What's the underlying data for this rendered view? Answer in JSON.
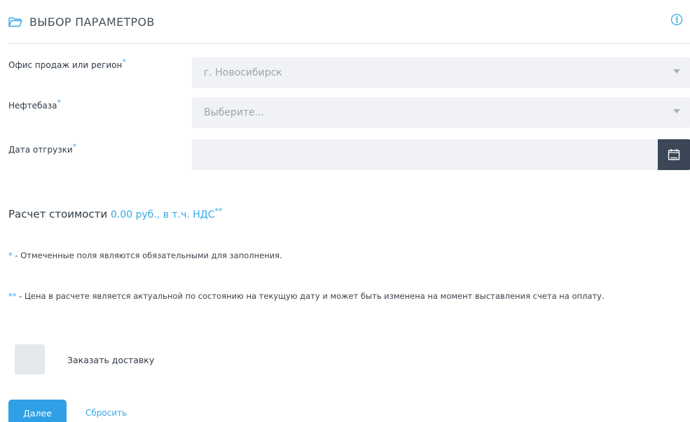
{
  "header": {
    "title": "ВЫБОР ПАРАМЕТРОВ",
    "folder_icon": "folder-icon",
    "info_icon": "info-icon"
  },
  "fields": {
    "office": {
      "label": "Офис продаж или регион",
      "required_mark": "*",
      "value": "г. Новосибирск"
    },
    "depot": {
      "label": "Нефтебаза",
      "required_mark": "*",
      "placeholder": "Выберите..."
    },
    "date": {
      "label": "Дата отгрузки",
      "required_mark": "*",
      "value": "",
      "icon": "calendar-icon"
    }
  },
  "cost": {
    "label": "Расчет стоимости",
    "amount": "0.00 руб., в т.ч. НДС",
    "mark": "**"
  },
  "notes": {
    "required": {
      "mark": "*",
      "text": " - Отмеченные поля являются обязательными для заполнения."
    },
    "price": {
      "mark": "**",
      "text": " - Цена в расчете является актуальной по состоянию на текущую дату и может быть изменена на момент выставления счета на оплату."
    }
  },
  "delivery": {
    "label": "Заказать доставку"
  },
  "actions": {
    "next_label": "Далее",
    "reset_label": "Сбросить"
  },
  "colors": {
    "accent": "#36a9e8",
    "primary_button": "#2f9fe6",
    "field_bg": "#f0f2f6",
    "calendar_button": "#3b4656"
  }
}
